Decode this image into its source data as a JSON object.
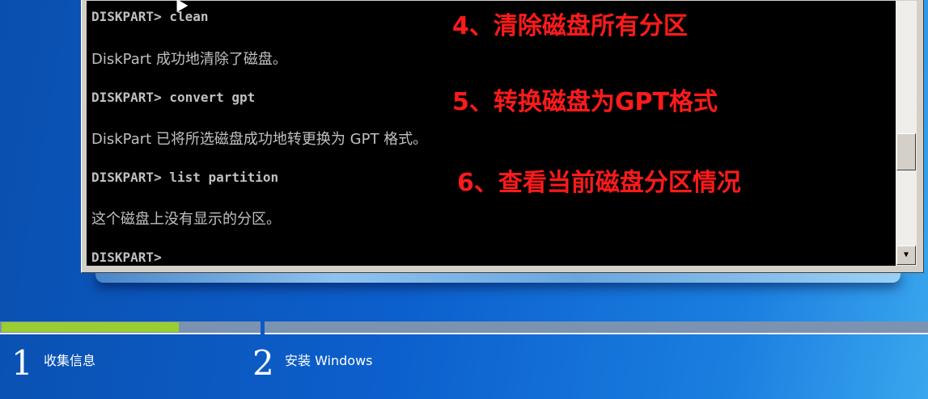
{
  "console": {
    "lines": [
      {
        "text": "DISKPART> clean",
        "type": "cmd"
      },
      {
        "text": "DiskPart 成功地清除了磁盘。",
        "type": "msg"
      },
      {
        "text": "DISKPART> convert gpt",
        "type": "cmd"
      },
      {
        "text": "DiskPart 已将所选磁盘成功地转更换为 GPT 格式。",
        "type": "msg"
      },
      {
        "text": "DISKPART> list partition",
        "type": "cmd"
      },
      {
        "text": "这个磁盘上没有显示的分区。",
        "type": "msg"
      },
      {
        "text": "DISKPART>",
        "type": "cmd"
      }
    ],
    "scroll_down_icon": "triangle-down"
  },
  "annotations": [
    "4、清除磁盘所有分区",
    "5、转换磁盘为GPT格式",
    "6、查看当前磁盘分区情况"
  ],
  "progress": {
    "step1_fraction": 0.69,
    "fill_color": "#9acd32"
  },
  "steps": [
    {
      "number": "1",
      "label": "收集信息"
    },
    {
      "number": "2",
      "label": "安装 Windows"
    }
  ]
}
